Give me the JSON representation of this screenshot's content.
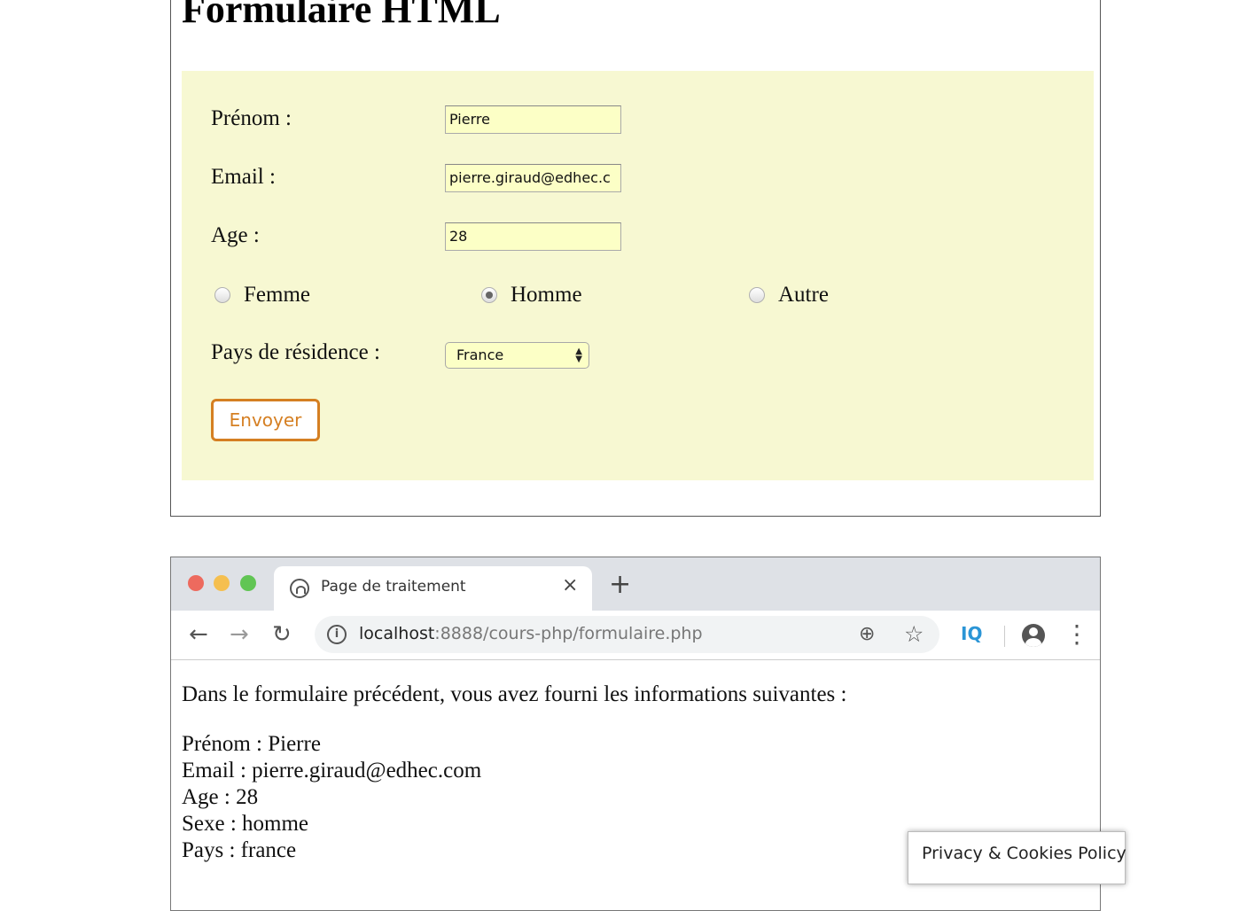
{
  "form_page": {
    "heading": "Formulaire HTML",
    "fields": {
      "prenom": {
        "label": "Prénom :",
        "value": "Pierre"
      },
      "email": {
        "label": "Email :",
        "value": "pierre.giraud@edhec.c"
      },
      "age": {
        "label": "Age :",
        "value": "28"
      }
    },
    "gender": {
      "options": [
        "Femme",
        "Homme",
        "Autre"
      ],
      "selected": "Homme"
    },
    "country": {
      "label": "Pays de résidence :",
      "selected": "France"
    },
    "submit_label": "Envoyer",
    "colors": {
      "form_background": "#f7f8d2",
      "input_background": "#fcffc6",
      "button_accent": "#d57f22"
    }
  },
  "browser": {
    "tab_title": "Page de traitement",
    "tab_close": "×",
    "new_tab": "+",
    "toolbar": {
      "back": "←",
      "forward": "→",
      "reload": "↻",
      "zoom": "⊕",
      "bookmark": "☆",
      "extension": "IQ",
      "menu": "⋮"
    },
    "url_host": "localhost",
    "url_path": ":8888/cours-php/formulaire.php",
    "icons": [
      "info-icon",
      "zoom-icon",
      "bookmark-star-icon",
      "extension-iq-icon",
      "account-icon",
      "menu-icon"
    ]
  },
  "result_page": {
    "intro": "Dans le formulaire précédent, vous avez fourni les informations suivantes :",
    "lines": [
      "Prénom : Pierre",
      "Email : pierre.giraud@edhec.com",
      "Age : 28",
      "Sexe : homme",
      "Pays : france"
    ]
  },
  "privacy_banner": "Privacy & Cookies Policy"
}
